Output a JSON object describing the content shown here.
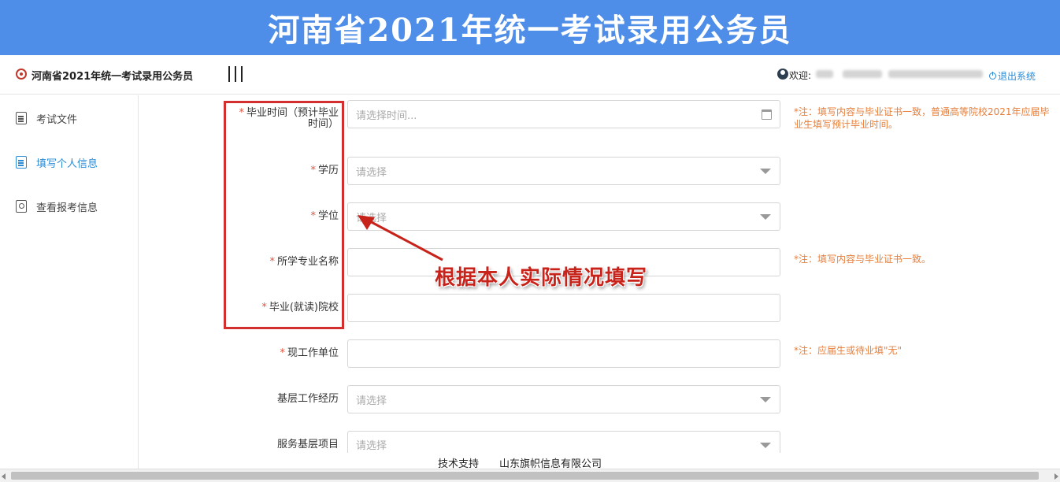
{
  "banner": {
    "title": "河南省2021年统一考试录用公务员"
  },
  "header": {
    "app_title": "河南省2021年统一考试录用公务员",
    "welcome": "欢迎:",
    "logout": "退出系统"
  },
  "sidebar": {
    "items": [
      {
        "label": "考试文件",
        "icon": "document-icon"
      },
      {
        "label": "填写个人信息",
        "icon": "edit-form-icon"
      },
      {
        "label": "查看报考信息",
        "icon": "view-info-icon"
      }
    ]
  },
  "form": {
    "graduation_time": {
      "label_line1": "毕业时间（预计毕业",
      "label_line2": "时间）",
      "placeholder": "请选择时间..."
    },
    "education": {
      "label": "学历",
      "value": "请选择"
    },
    "degree": {
      "label": "学位",
      "value": "请选择"
    },
    "major": {
      "label": "所学专业名称",
      "value": ""
    },
    "school": {
      "label": "毕业(就读)院校",
      "value": ""
    },
    "employer": {
      "label": "现工作单位",
      "value": ""
    },
    "grassroots_experience": {
      "label": "基层工作经历",
      "value": "请选择"
    },
    "grassroots_project": {
      "label": "服务基层项目",
      "value": "请选择"
    }
  },
  "notes": {
    "graduation": "*注：填写内容与毕业证书一致，普通高等院校2021年应届毕业生填写预计毕业时间。",
    "major": "*注：填写内容与毕业证书一致。",
    "employer": "*注：应届生或待业填\"无\""
  },
  "annotation": {
    "text": "根据本人实际情况填写"
  },
  "footer": {
    "support_label": "技术支持",
    "company": "山东旗帜信息有限公司"
  },
  "colors": {
    "banner": "#4e8ee8",
    "accent": "#2a8bd6",
    "required": "#e5533e",
    "note": "#e67e3a",
    "annotation": "#c8231b"
  }
}
